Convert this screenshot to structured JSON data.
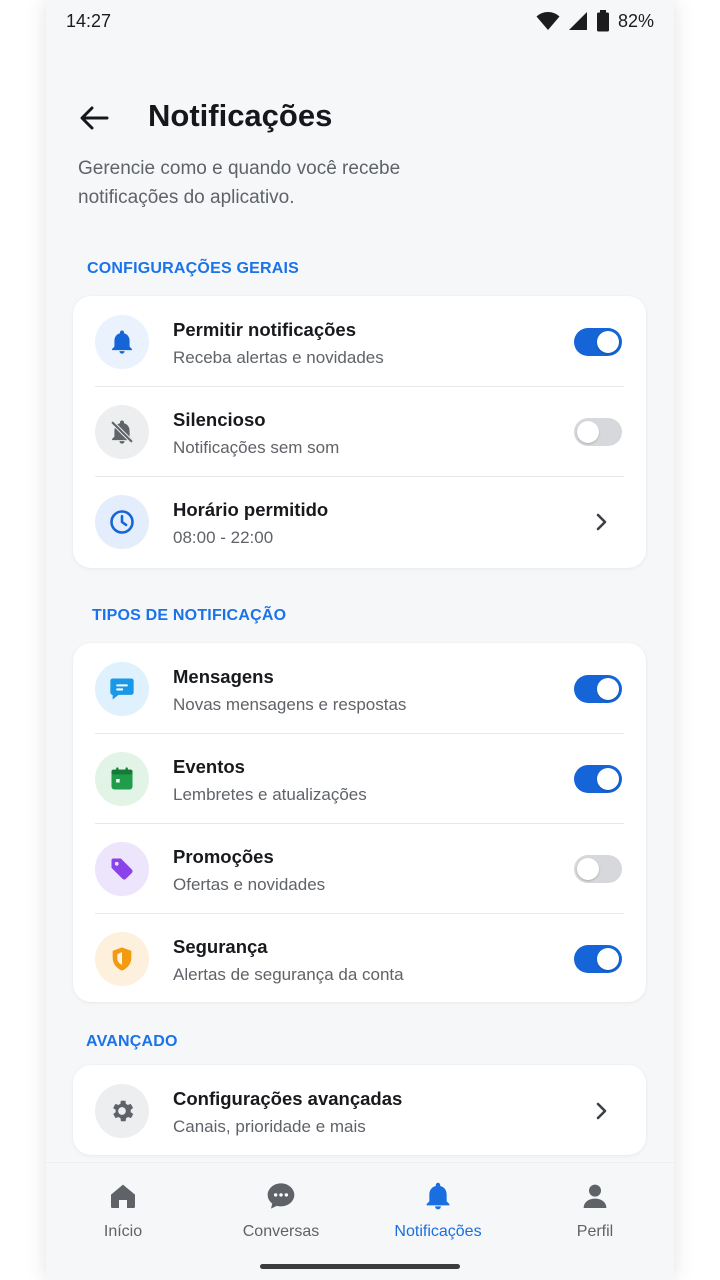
{
  "status_bar": {
    "time": "14:27",
    "battery": "82%"
  },
  "header": {
    "title": "Notificações"
  },
  "subtitle": "Gerencie como e quando você recebe notificações do aplicativo.",
  "sections": {
    "general": {
      "label": "CONFIGURAÇÕES GERAIS",
      "rows": [
        {
          "title": "Permitir notificações",
          "desc": "Receba alertas e novidades",
          "icon": "bell-icon",
          "control": "toggle",
          "enabled": true
        },
        {
          "title": "Silencioso",
          "desc": "Notificações sem som",
          "icon": "bell-off-icon",
          "control": "toggle",
          "enabled": false
        },
        {
          "title": "Horário permitido",
          "desc": "08:00 - 22:00",
          "icon": "clock-icon",
          "control": "chevron"
        }
      ]
    },
    "types": {
      "label": "TIPOS DE NOTIFICAÇÃO",
      "rows": [
        {
          "title": "Mensagens",
          "desc": "Novas mensagens e respostas",
          "icon": "message-icon",
          "control": "toggle",
          "enabled": true
        },
        {
          "title": "Eventos",
          "desc": "Lembretes e atualizações",
          "icon": "calendar-icon",
          "control": "toggle",
          "enabled": true
        },
        {
          "title": "Promoções",
          "desc": "Ofertas e novidades",
          "icon": "tag-icon",
          "control": "toggle",
          "enabled": false
        },
        {
          "title": "Segurança",
          "desc": "Alertas de segurança da conta",
          "icon": "shield-icon",
          "control": "toggle",
          "enabled": true
        }
      ]
    },
    "advanced": {
      "label": "AVANÇADO",
      "rows": [
        {
          "title": "Configurações avançadas",
          "desc": "Canais, prioridade e mais",
          "icon": "gear-icon",
          "control": "chevron"
        }
      ]
    }
  },
  "bottom_nav": {
    "items": [
      {
        "label": "Início",
        "icon": "home-icon",
        "active": false
      },
      {
        "label": "Conversas",
        "icon": "chat-icon",
        "active": false
      },
      {
        "label": "Notificações",
        "icon": "bell-icon",
        "active": true
      },
      {
        "label": "Perfil",
        "icon": "person-icon",
        "active": false
      }
    ]
  },
  "colors": {
    "accent": "#1565d8",
    "background": "#f6f7f9",
    "toggle_off": "#d6d8dc"
  }
}
